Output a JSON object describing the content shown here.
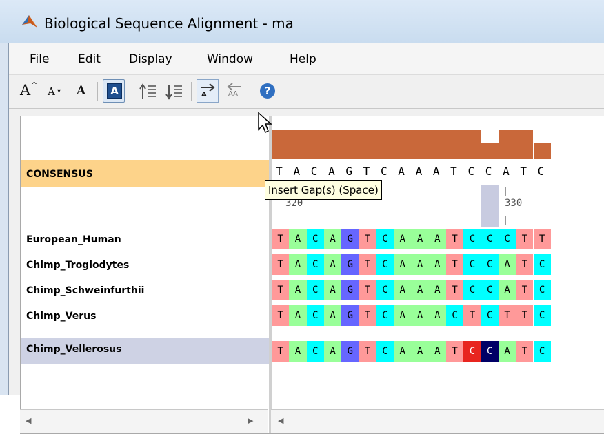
{
  "window": {
    "title": "Biological Sequence Alignment - ma"
  },
  "menu": [
    "File",
    "Edit",
    "Display",
    "Window",
    "Help"
  ],
  "toolbar": {
    "increase_font_label": "A",
    "decrease_font_label": "A",
    "reset_font_label": "A",
    "color_mode_label": "A",
    "insert_gap_label": "A",
    "remove_gap_label": "AA",
    "help_label": "?"
  },
  "tooltip": "Insert Gap(s) (Space)",
  "consensus": {
    "label": "CONSENSUS",
    "sequence": [
      "T",
      "A",
      "C",
      "A",
      "G",
      "T",
      "C",
      "A",
      "A",
      "A",
      "T",
      "C",
      "C",
      "A",
      "T",
      "C"
    ]
  },
  "ruler": {
    "labels": [
      "320",
      "330"
    ]
  },
  "sequences": [
    {
      "name": "European_Human",
      "residues": [
        "T",
        "A",
        "C",
        "A",
        "G",
        "T",
        "C",
        "A",
        "A",
        "A",
        "T",
        "C",
        "C",
        "C",
        "T",
        "T"
      ]
    },
    {
      "name": "Chimp_Troglodytes",
      "residues": [
        "T",
        "A",
        "C",
        "A",
        "G",
        "T",
        "C",
        "A",
        "A",
        "A",
        "T",
        "C",
        "C",
        "A",
        "T",
        "C"
      ]
    },
    {
      "name": "Chimp_Schweinfurthii",
      "residues": [
        "T",
        "A",
        "C",
        "A",
        "G",
        "T",
        "C",
        "A",
        "A",
        "A",
        "T",
        "C",
        "C",
        "A",
        "T",
        "C"
      ]
    },
    {
      "name": "Chimp_Verus",
      "residues": [
        "T",
        "A",
        "C",
        "A",
        "G",
        "T",
        "C",
        "A",
        "A",
        "A",
        "C",
        "T",
        "C",
        "T",
        "T",
        "C"
      ]
    },
    {
      "name": "Chimp_Vellerosus",
      "residues": [
        "T",
        "A",
        "C",
        "A",
        "G",
        "T",
        "C",
        "A",
        "A",
        "A",
        "T",
        "C",
        "C",
        "A",
        "T",
        "C"
      ]
    }
  ],
  "selected_row": "Chimp_Vellerosus",
  "colors": {
    "A": "#99ff99",
    "C": "#00ffff",
    "G": "#6666ff",
    "T": "#ff9999",
    "consensus_band": "#fdd38a",
    "conservation_bar": "#c9683a",
    "selected_row": "#ced2e4",
    "cursor_cell": "#000066",
    "cursor_marker": "#e8251f"
  }
}
